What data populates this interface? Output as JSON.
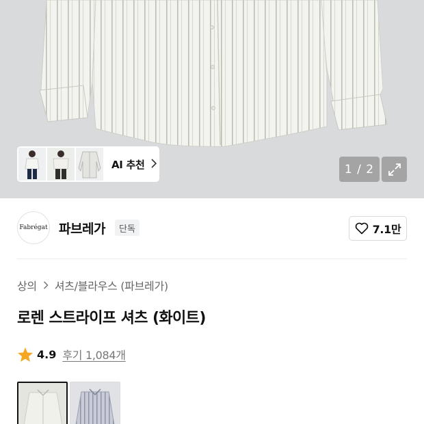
{
  "gallery": {
    "ai_recommend_label": "AI 추천",
    "pager": "1 / 2",
    "thumbnails": [
      "model-white-shirt",
      "model-short-sleeve-shirt",
      "striped-shirt"
    ]
  },
  "brand": {
    "logo_text": "Fabrégat",
    "name": "파브레가",
    "badge": "단독",
    "like_count": "7.1만"
  },
  "product": {
    "breadcrumb": [
      "상의",
      "셔츠/블라우스 (파브레가)"
    ],
    "title": "로렌 스트라이프 셔츠 (화이트)",
    "rating": "4.9",
    "review_label": "후기 1,084개"
  },
  "color_options": [
    {
      "name": "white-stripe",
      "selected": true
    },
    {
      "name": "blue-stripe",
      "selected": false
    }
  ],
  "colors": {
    "hero_bg": "#d9dadc",
    "shirt": "#f3f3ef",
    "star": "#f5a623"
  }
}
